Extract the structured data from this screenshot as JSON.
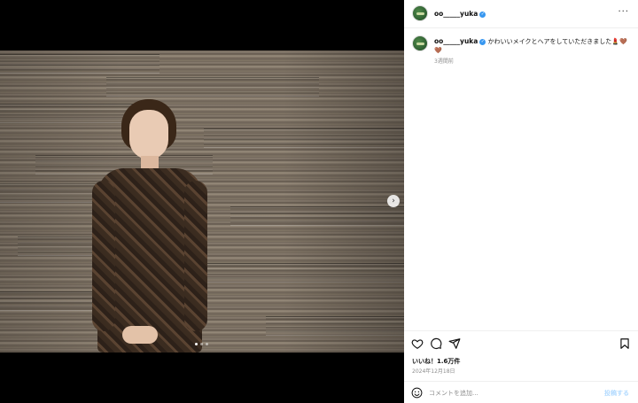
{
  "post": {
    "username": "oo_____yuka",
    "caption_text": "かわいいメイクとヘアをしていただきました💄🤎🤎",
    "caption_time": "3週間前",
    "likes_text": "いいね！1.6万件",
    "date_text": "2024年12月18日",
    "more_icon": "···"
  },
  "comment": {
    "placeholder": "コメントを追加...",
    "post_label": "投稿する"
  },
  "carousel": {
    "next_icon": "›",
    "slide_count": 3,
    "active_slide": 1
  },
  "icons": [
    "heart-icon",
    "comment-icon",
    "share-icon",
    "bookmark-icon",
    "emoji-icon",
    "verified-icon",
    "more-icon",
    "chevron-right-icon"
  ],
  "colors": {
    "verified": "#3897f0",
    "post_button": "#b3dbff",
    "muted_text": "#8e8e8e"
  }
}
